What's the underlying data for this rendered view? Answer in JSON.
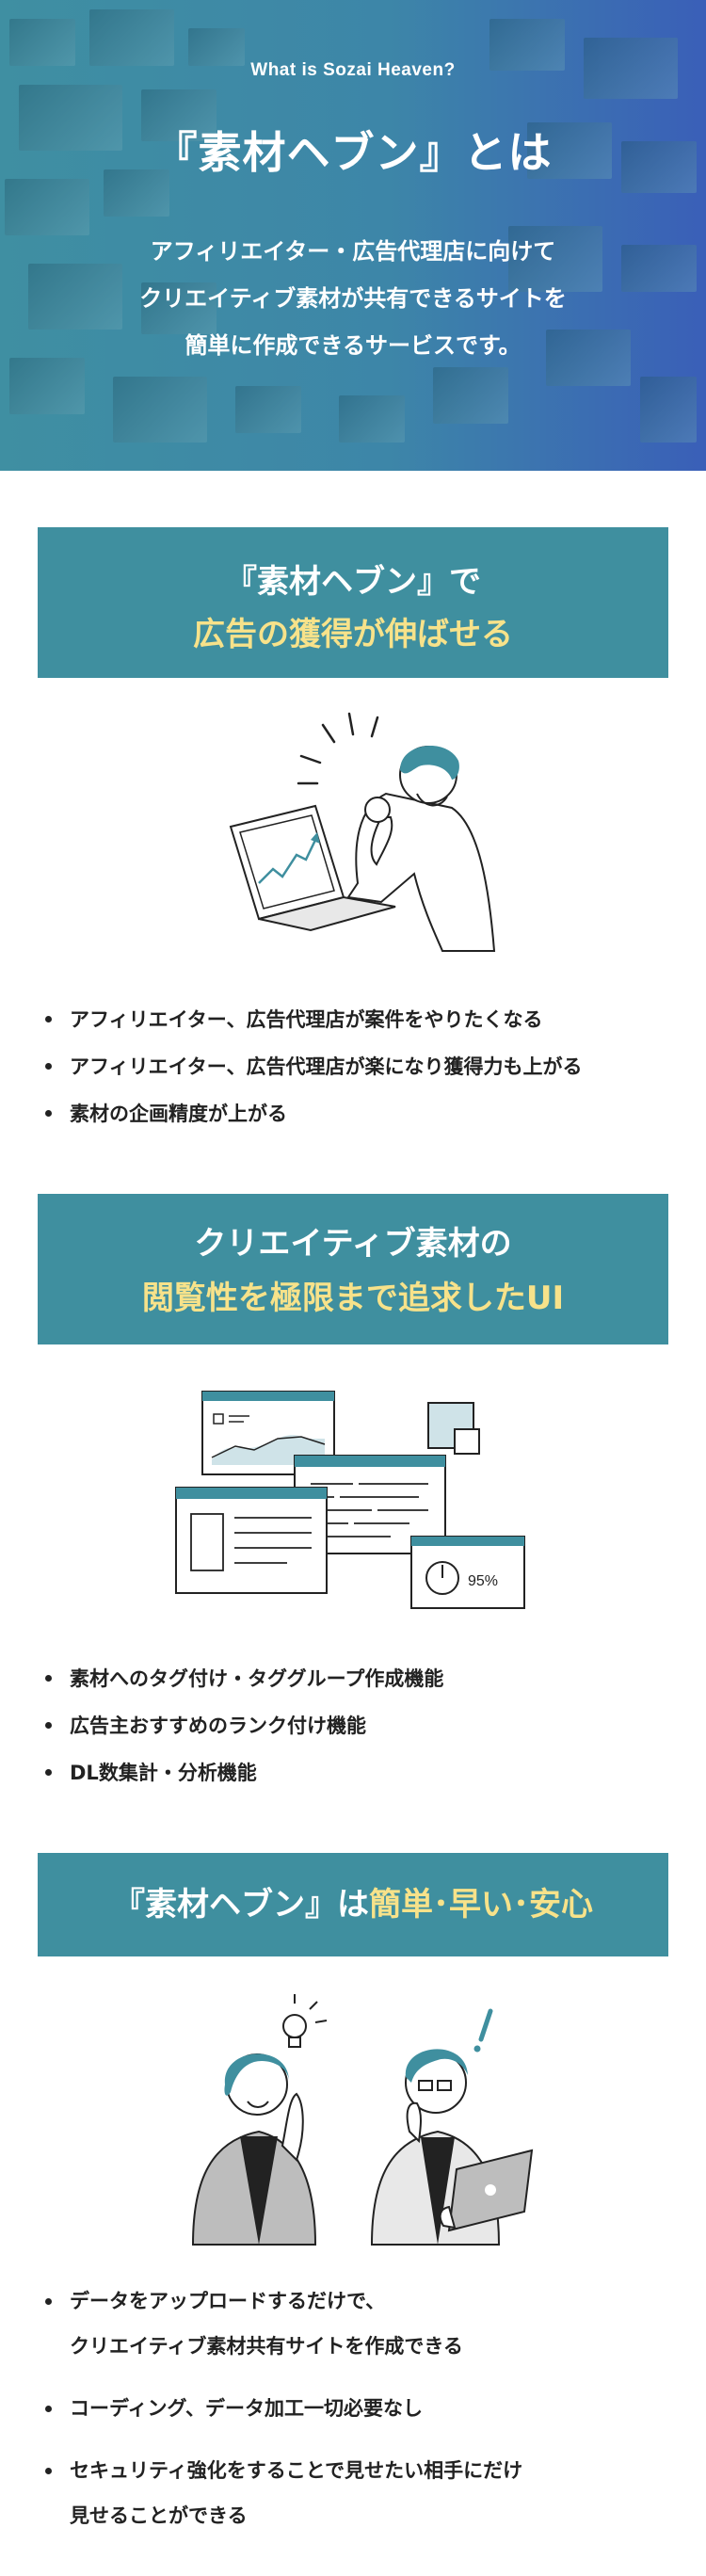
{
  "hero": {
    "eyebrow": "What is Sozai Heaven?",
    "title": "『素材ヘブン』とは",
    "desc_lines": [
      "アフィリエイター・広告代理店に向けて",
      "クリエイティブ素材が共有できるサイトを",
      "簡単に作成できるサービスです。"
    ]
  },
  "section1": {
    "heading_line1": "『素材ヘブン』で",
    "heading_line2": "広告の獲得が伸ばせる",
    "bullets": [
      "アフィリエイター、広告代理店が案件をやりたくなる",
      "アフィリエイター、広告代理店が楽になり獲得力も上がる",
      "素材の企画精度が上がる"
    ]
  },
  "section2": {
    "heading_line1": "クリエイティブ素材の",
    "heading_line2": "閲覧性を極限まで追求したUI",
    "chart_label": "95%",
    "bullets": [
      "素材へのタグ付け・タググループ作成機能",
      "広告主おすすめのランク付け機能",
      "DL数集計・分析機能"
    ]
  },
  "section3": {
    "heading_prefix": "『素材ヘブン』は",
    "heading_highlight": "簡単･早い･安心",
    "bullets": [
      "データをアップロードするだけで、",
      "クリエイティブ素材共有サイトを作成できる",
      "コーディング、データ加工一切必要なし",
      "セキュリティ強化をすることで見せたい相手にだけ",
      "見せることができる"
    ]
  },
  "colors": {
    "banner": "#3f8f9f",
    "highlight": "#f7e28a",
    "accent": "#3f8f9f"
  }
}
